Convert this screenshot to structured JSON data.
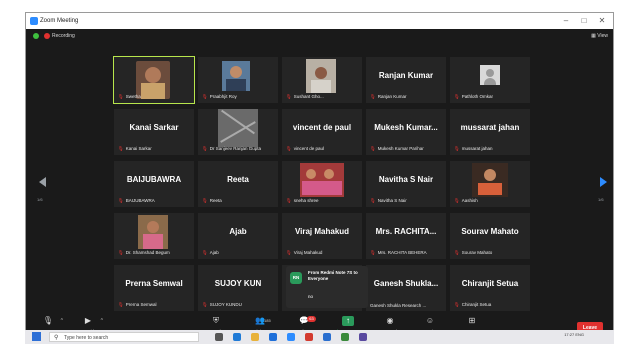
{
  "window": {
    "title": "Zoom Meeting",
    "recording_label": "Recording",
    "view_label": "View",
    "minimize_glyph": "–",
    "maximize_glyph": "□",
    "close_glyph": "✕"
  },
  "pagination": {
    "left": "1/6",
    "right": "1/6"
  },
  "tiles": [
    {
      "display": "",
      "label": "Swetha",
      "active": true
    },
    {
      "display": "",
      "label": "Praabhjit Roy"
    },
    {
      "display": "",
      "label": "Sushant Gho..."
    },
    {
      "display": "Ranjan Kumar",
      "label": "Ranjan Kumar"
    },
    {
      "display": "",
      "label": "Pathloth Omkar"
    },
    {
      "display": "Kanai Sarkar",
      "label": "Kanai Sarkar"
    },
    {
      "display": "",
      "label": "Dr Sanjeev Ranjan Gupta"
    },
    {
      "display": "vincent de paul",
      "label": "vincent de paul"
    },
    {
      "display": "Mukesh Kumar...",
      "label": "Mukesh Kumar Parihar"
    },
    {
      "display": "mussarat jahan",
      "label": "mussarat jahan"
    },
    {
      "display": "BAIJUBAWRA",
      "label": "BAIJUBAWRA"
    },
    {
      "display": "Reeta",
      "label": "Reeta"
    },
    {
      "display": "",
      "label": "sneha shree"
    },
    {
      "display": "Navitha S Nair",
      "label": "Navitha S Nair"
    },
    {
      "display": "",
      "label": "Aashish"
    },
    {
      "display": "",
      "label": "Dr. Shamshad Begum"
    },
    {
      "display": "Ajab",
      "label": "Ajab"
    },
    {
      "display": "Viraj Mahakud",
      "label": "Viraj Mahakud"
    },
    {
      "display": "Mrs. RACHITA...",
      "label": "Mrs. RACHITA BEHERA"
    },
    {
      "display": "Sourav Mahato",
      "label": "Sourav Mahato"
    },
    {
      "display": "Prerna Semwal",
      "label": "Prerna Semwal"
    },
    {
      "display": "SUJOY KUN",
      "label": "SUJOY KUNDU"
    },
    {
      "display": "",
      "label": ""
    },
    {
      "display": "Ganesh Shukla...",
      "label": "Ganesh Shukla Research ..."
    },
    {
      "display": "Chiranjit Setua",
      "label": "Chiranjit Setua"
    }
  ],
  "chat_popup": {
    "avatar": "RN",
    "from": "From Redmi Note 7S to Everyone",
    "message": "no"
  },
  "toolbar": {
    "unmute": "Unmute",
    "start_video": "Start Video",
    "security": "Security",
    "participants": "Participants",
    "participants_count": "185",
    "chat": "Chat",
    "chat_badge": "63",
    "share_screen": "Share Screen",
    "record": "Record",
    "reactions": "Reactions",
    "apps": "Apps",
    "leave": "Leave"
  },
  "taskbar": {
    "search_placeholder": "Type here to search",
    "time": "17:27",
    "lang": "ENG"
  },
  "colors": {
    "accent": "#2d8cff",
    "leave": "#e0312f",
    "share": "#2a9a5b",
    "active_border": "#b7e64c"
  }
}
